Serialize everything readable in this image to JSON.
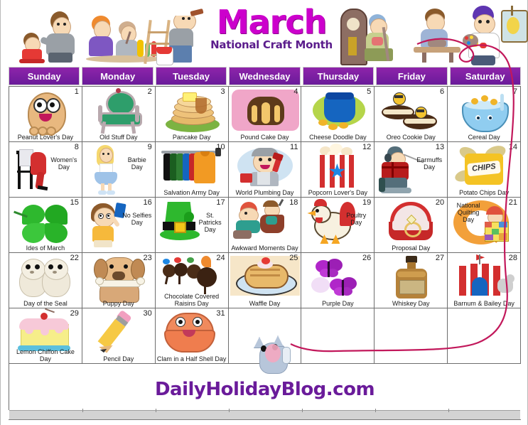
{
  "header": {
    "month_title": "March",
    "subtitle": "National Craft Month",
    "title_color": "#cc00cc",
    "subtitle_color": "#5b1d8c"
  },
  "weekdays": [
    {
      "label": "Sunday"
    },
    {
      "label": "Monday"
    },
    {
      "label": "Tuesday"
    },
    {
      "label": "Wednesday"
    },
    {
      "label": "Thursday"
    },
    {
      "label": "Friday"
    },
    {
      "label": "Saturday"
    }
  ],
  "theme": {
    "header_bar_color": "#7b1fa2",
    "header_bar_text": "#ffffff",
    "grid_line_color": "#6d6d6d",
    "footer_color": "#6a1b9a",
    "yarn_color": "#c2185b"
  },
  "weeks": [
    [
      {
        "day": "1",
        "title": "Peanut Lover's Day",
        "icon": "peanut-character-icon",
        "layout": "bottom"
      },
      {
        "day": "2",
        "title": "Old Stuff Day",
        "icon": "antique-chair-icon",
        "layout": "bottom"
      },
      {
        "day": "3",
        "title": "Pancake Day",
        "icon": "pancake-stack-icon",
        "layout": "bottom"
      },
      {
        "day": "4",
        "title": "Pound Cake Day",
        "icon": "pound-cake-icon",
        "layout": "bottom"
      },
      {
        "day": "5",
        "title": "Cheese Doodle Day",
        "icon": "snack-bag-icon",
        "layout": "bottom"
      },
      {
        "day": "6",
        "title": "Oreo Cookie Day",
        "icon": "sandwich-cookie-bees-icon",
        "layout": "bottom"
      },
      {
        "day": "7",
        "title": "Cereal Day",
        "icon": "cereal-bowl-icon",
        "layout": "bottom"
      }
    ],
    [
      {
        "day": "8",
        "title": "Women's Day",
        "icon": "red-dress-stool-icon",
        "layout": "side"
      },
      {
        "day": "9",
        "title": "Barbie Day",
        "icon": "doll-icon",
        "layout": "side"
      },
      {
        "day": "10",
        "title": "Salvation Army Day",
        "icon": "clothes-rack-icon",
        "layout": "bottom"
      },
      {
        "day": "11",
        "title": "World Plumbing Day",
        "icon": "plumber-icon",
        "layout": "bottom"
      },
      {
        "day": "12",
        "title": "Popcorn Lover's Day",
        "icon": "popcorn-bucket-icon",
        "layout": "bottom"
      },
      {
        "day": "13",
        "title": "Earmuffs Day",
        "icon": "ice-fisherman-icon",
        "layout": "side"
      },
      {
        "day": "14",
        "title": "Potato Chips Day",
        "icon": "chips-bag-icon",
        "layout": "bottom"
      }
    ],
    [
      {
        "day": "15",
        "title": "Ides of March",
        "icon": "four-leaf-clover-icon",
        "layout": "bottom"
      },
      {
        "day": "16",
        "title": "No Selfies Day",
        "icon": "girl-selfie-icon",
        "layout": "side"
      },
      {
        "day": "17",
        "title": "St. Patricks Day",
        "icon": "leprechaun-hat-icon",
        "layout": "side"
      },
      {
        "day": "18",
        "title": "Awkward Moments Day",
        "icon": "awkward-people-icon",
        "layout": "bottom"
      },
      {
        "day": "19",
        "title": "Poultry Day",
        "icon": "chicken-icon",
        "layout": "side"
      },
      {
        "day": "20",
        "title": "Proposal Day",
        "icon": "ring-box-icon",
        "layout": "bottom"
      },
      {
        "day": "21",
        "title": "National Quilting Day",
        "icon": "quilt-child-icon",
        "layout": "topleft"
      }
    ],
    [
      {
        "day": "22",
        "title": "Day of the Seal",
        "icon": "seal-pups-icon",
        "layout": "bottom"
      },
      {
        "day": "23",
        "title": "Puppy Day",
        "icon": "puppy-bone-icon",
        "layout": "bottom"
      },
      {
        "day": "24",
        "title": "Chocolate Covered Raisins  Day",
        "icon": "chocolate-raisins-icon",
        "layout": "bottom"
      },
      {
        "day": "25",
        "title": "Waffle Day",
        "icon": "waffle-plate-icon",
        "layout": "bottom"
      },
      {
        "day": "26",
        "title": "Purple Day",
        "icon": "purple-butterflies-icon",
        "layout": "bottom"
      },
      {
        "day": "27",
        "title": "Whiskey Day",
        "icon": "whiskey-bottle-icon",
        "layout": "bottom"
      },
      {
        "day": "28",
        "title": "Barnum & Bailey Day",
        "icon": "circus-tent-icon",
        "layout": "bottom"
      }
    ],
    [
      {
        "day": "29",
        "title": "Lemon Chiffon Cake Day",
        "icon": "layer-cake-icon",
        "layout": "bottom"
      },
      {
        "day": "30",
        "title": "Pencil Day",
        "icon": "pencil-icon",
        "layout": "bottom"
      },
      {
        "day": "31",
        "title": "Clam in a Half Shell Day",
        "icon": "clam-icon",
        "layout": "bottom"
      },
      {
        "day": "",
        "title": "",
        "icon": "",
        "layout": "bottom"
      },
      {
        "day": "",
        "title": "",
        "icon": "",
        "layout": "bottom"
      },
      {
        "day": "",
        "title": "",
        "icon": "",
        "layout": "bottom"
      },
      {
        "day": "",
        "title": "",
        "icon": "",
        "layout": "bottom"
      }
    ]
  ],
  "footer": {
    "url": "DailyHolidayBlog.com"
  }
}
